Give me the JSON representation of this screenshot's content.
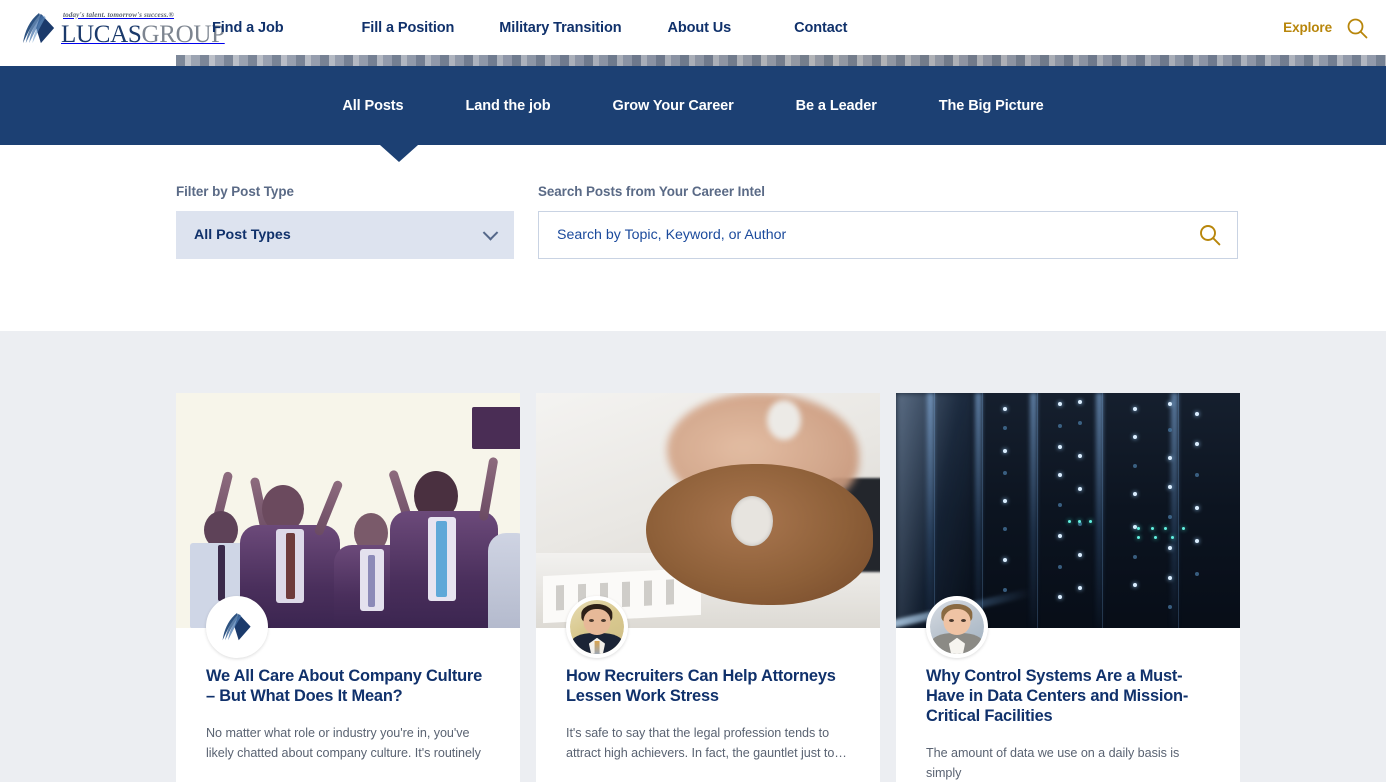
{
  "brand": {
    "logo_tagline": "today's talent. tomorrow's success.®",
    "logo_name_primary": "LUCAS",
    "logo_name_secondary": "GROUP",
    "logo_mark_icon": "lucas-diamond-feather-icon",
    "primary_blue": "#10316b",
    "nav_blue": "#1c4073",
    "accent_gold": "#b8860b",
    "section_bg": "#eceef2"
  },
  "header": {
    "nav_items": [
      {
        "label": "Find a Job"
      },
      {
        "label": "Fill a Position"
      },
      {
        "label": "Military Transition"
      },
      {
        "label": "About Us"
      },
      {
        "label": "Contact"
      }
    ],
    "explore_label": "Explore",
    "search_icon": "search-icon"
  },
  "subnav": {
    "items": [
      {
        "label": "All Posts",
        "active": true
      },
      {
        "label": "Land the job",
        "active": false
      },
      {
        "label": "Grow Your Career",
        "active": false
      },
      {
        "label": "Be a Leader",
        "active": false
      },
      {
        "label": "The Big Picture",
        "active": false
      }
    ]
  },
  "filters": {
    "filter_label": "Filter by Post Type",
    "post_type_selected": "All Post Types",
    "post_type_chevron_icon": "chevron-down-icon",
    "search_label": "Search Posts from Your Career Intel",
    "search_placeholder": "Search by Topic, Keyword, or Author",
    "search_value": "",
    "search_submit_icon": "search-icon"
  },
  "posts": [
    {
      "title": "We All Care About Company Culture – But What Does It Mean?",
      "excerpt": "No matter what role or industry you're in, you've likely chatted about company culture. It's routinely",
      "image_alt": "celebrating-business-team-image",
      "avatar_type": "brand-logo",
      "avatar_alt": "lucas-group-logo-avatar"
    },
    {
      "title": "How Recruiters Can Help Attorneys Lessen Work Stress",
      "excerpt": "It's safe to say that the legal profession tends to attract high achievers. In fact, the gauntlet just to…",
      "image_alt": "meditating-hands-at-desk-image",
      "avatar_type": "person",
      "avatar_alt": "author-headshot-avatar"
    },
    {
      "title": "Why Control Systems Are a Must-Have in Data Centers and Mission-Critical Facilities",
      "excerpt": "The amount of data we use on a daily basis is simply",
      "image_alt": "data-center-server-racks-image",
      "avatar_type": "person",
      "avatar_alt": "author-headshot-avatar"
    }
  ]
}
